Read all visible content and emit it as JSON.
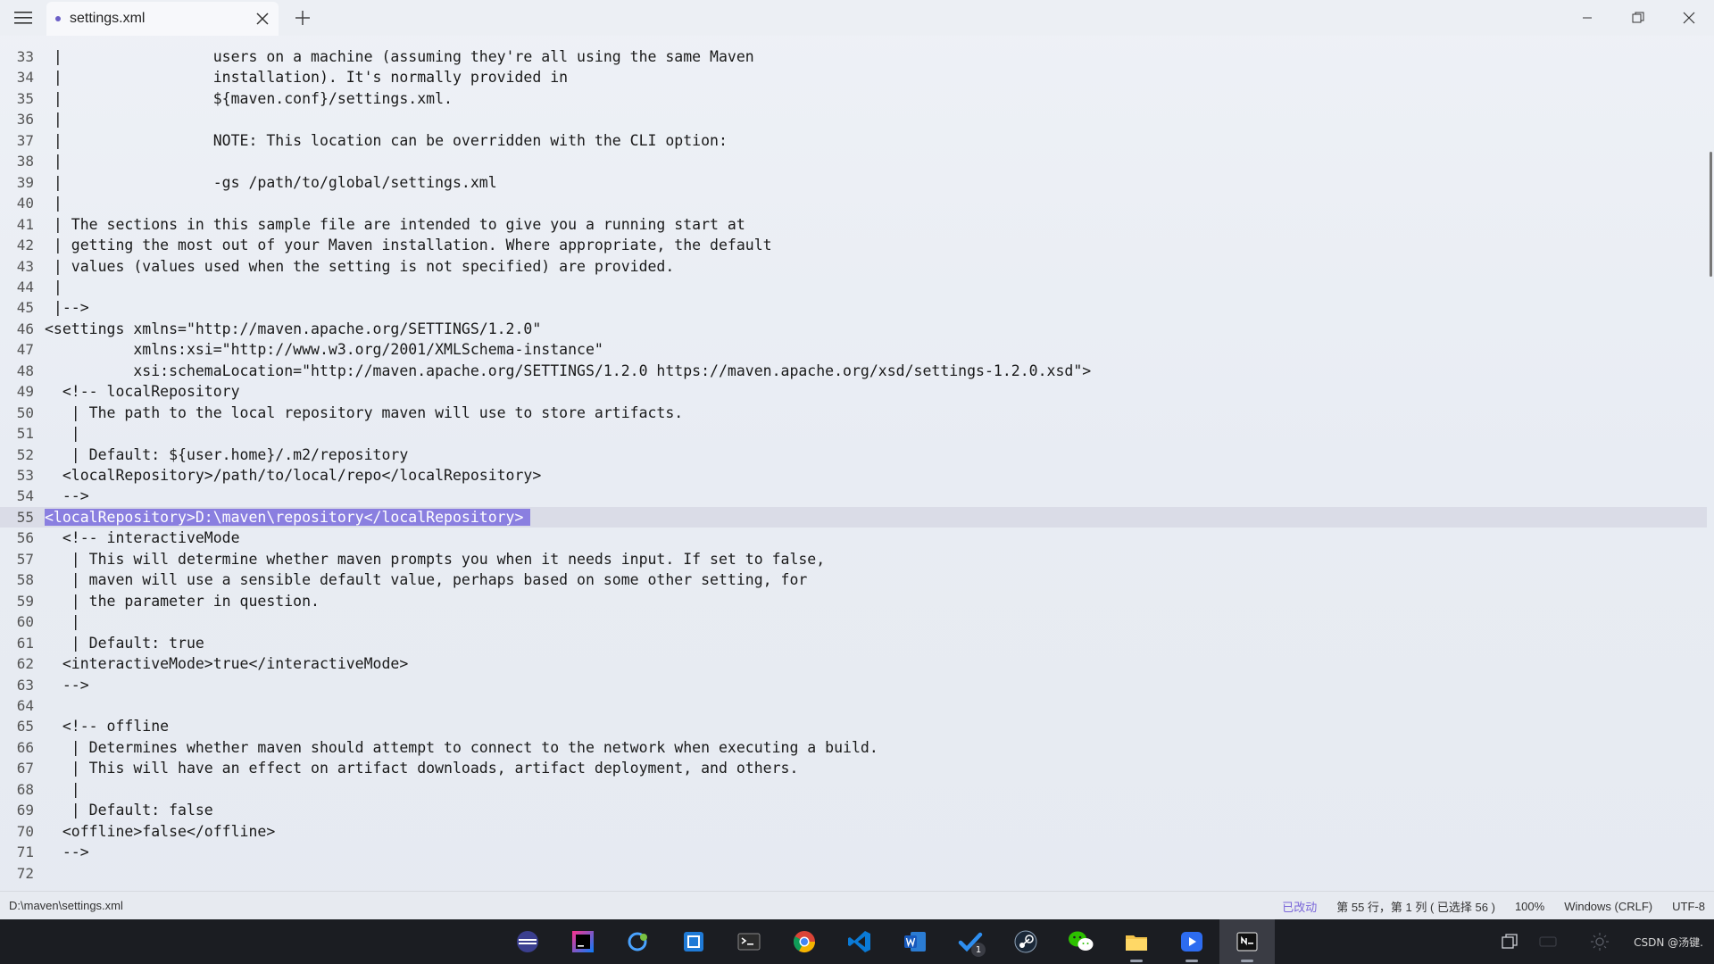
{
  "tab": {
    "title": "settings.xml"
  },
  "icons": {
    "menu": "hamburger-icon",
    "close_tab": "close-icon",
    "new_tab": "plus-icon",
    "minimize": "minimize-icon",
    "restore": "restore-icon",
    "close_window": "close-icon"
  },
  "editor": {
    "current_line": 55,
    "selected_line": 55,
    "lines": [
      {
        "n": "33",
        "text": " |                 users on a machine (assuming they're all using the same Maven"
      },
      {
        "n": "34",
        "text": " |                 installation). It's normally provided in"
      },
      {
        "n": "35",
        "text": " |                 ${maven.conf}/settings.xml."
      },
      {
        "n": "36",
        "text": " |"
      },
      {
        "n": "37",
        "text": " |                 NOTE: This location can be overridden with the CLI option:"
      },
      {
        "n": "38",
        "text": " |"
      },
      {
        "n": "39",
        "text": " |                 -gs /path/to/global/settings.xml"
      },
      {
        "n": "40",
        "text": " |"
      },
      {
        "n": "41",
        "text": " | The sections in this sample file are intended to give you a running start at"
      },
      {
        "n": "42",
        "text": " | getting the most out of your Maven installation. Where appropriate, the default"
      },
      {
        "n": "43",
        "text": " | values (values used when the setting is not specified) are provided."
      },
      {
        "n": "44",
        "text": " |"
      },
      {
        "n": "45",
        "text": " |-->"
      },
      {
        "n": "46",
        "text": "<settings xmlns=\"http://maven.apache.org/SETTINGS/1.2.0\""
      },
      {
        "n": "47",
        "text": "          xmlns:xsi=\"http://www.w3.org/2001/XMLSchema-instance\""
      },
      {
        "n": "48",
        "text": "          xsi:schemaLocation=\"http://maven.apache.org/SETTINGS/1.2.0 https://maven.apache.org/xsd/settings-1.2.0.xsd\">"
      },
      {
        "n": "49",
        "text": "  <!-- localRepository"
      },
      {
        "n": "50",
        "text": "   | The path to the local repository maven will use to store artifacts."
      },
      {
        "n": "51",
        "text": "   |"
      },
      {
        "n": "52",
        "text": "   | Default: ${user.home}/.m2/repository"
      },
      {
        "n": "53",
        "text": "  <localRepository>/path/to/local/repo</localRepository>"
      },
      {
        "n": "54",
        "text": "  -->"
      },
      {
        "n": "55",
        "text": "<localRepository>D:\\maven\\repository</localRepository>"
      },
      {
        "n": "56",
        "text": "  <!-- interactiveMode"
      },
      {
        "n": "57",
        "text": "   | This will determine whether maven prompts you when it needs input. If set to false,"
      },
      {
        "n": "58",
        "text": "   | maven will use a sensible default value, perhaps based on some other setting, for"
      },
      {
        "n": "59",
        "text": "   | the parameter in question."
      },
      {
        "n": "60",
        "text": "   |"
      },
      {
        "n": "61",
        "text": "   | Default: true"
      },
      {
        "n": "62",
        "text": "  <interactiveMode>true</interactiveMode>"
      },
      {
        "n": "63",
        "text": "  -->"
      },
      {
        "n": "64",
        "text": ""
      },
      {
        "n": "65",
        "text": "  <!-- offline"
      },
      {
        "n": "66",
        "text": "   | Determines whether maven should attempt to connect to the network when executing a build."
      },
      {
        "n": "67",
        "text": "   | This will have an effect on artifact downloads, artifact deployment, and others."
      },
      {
        "n": "68",
        "text": "   |"
      },
      {
        "n": "69",
        "text": "   | Default: false"
      },
      {
        "n": "70",
        "text": "  <offline>false</offline>"
      },
      {
        "n": "71",
        "text": "  -->"
      },
      {
        "n": "72",
        "text": ""
      }
    ]
  },
  "status": {
    "path": "D:\\maven\\settings.xml",
    "modified": "已改动",
    "position": "第 55 行，第 1 列 ( 已选择 56 )",
    "zoom": "100%",
    "line_ending": "Windows (CRLF)",
    "encoding": "UTF-8"
  },
  "taskbar": {
    "apps": [
      {
        "name": "eclipse-icon",
        "running": false
      },
      {
        "name": "intellij-icon",
        "running": false
      },
      {
        "name": "navicat-icon",
        "running": false
      },
      {
        "name": "remote-desktop-icon",
        "running": false
      },
      {
        "name": "terminal-icon",
        "running": false
      },
      {
        "name": "chrome-icon",
        "running": false
      },
      {
        "name": "vscode-icon",
        "running": false
      },
      {
        "name": "word-icon",
        "running": false
      },
      {
        "name": "todo-icon",
        "running": false,
        "badge": "1"
      },
      {
        "name": "steam-icon",
        "running": false
      },
      {
        "name": "wechat-icon",
        "running": false
      },
      {
        "name": "file-explorer-icon",
        "running": true
      },
      {
        "name": "media-player-icon",
        "running": true
      },
      {
        "name": "notepad-icon",
        "running": true,
        "active": true
      }
    ],
    "watermark": "CSDN @汤键."
  },
  "colors": {
    "selection": "#8a7fe0",
    "accent": "#6b5fc7",
    "taskbar": "#1b1d22"
  }
}
